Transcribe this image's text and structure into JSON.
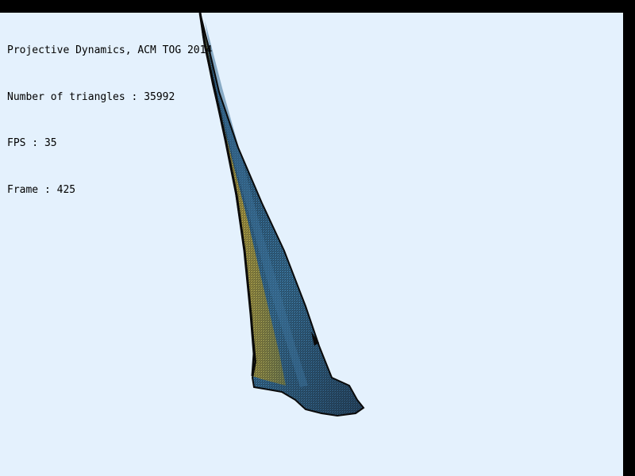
{
  "hud": {
    "title": "Projective Dynamics, ACM TOG 2014",
    "triangles_label": "Number of triangles : ",
    "triangles_value": "35992",
    "fps_label": "FPS : ",
    "fps_value": "35",
    "frame_label": "Frame : ",
    "frame_value": "425"
  },
  "colors": {
    "background": "#e4f1fd",
    "window_border": "#000000",
    "cloth_front": "#b6a74a",
    "cloth_back": "#3d7ca8",
    "mesh_lines": "#0a0a0a"
  },
  "scene": {
    "object": "cloth-mesh"
  }
}
